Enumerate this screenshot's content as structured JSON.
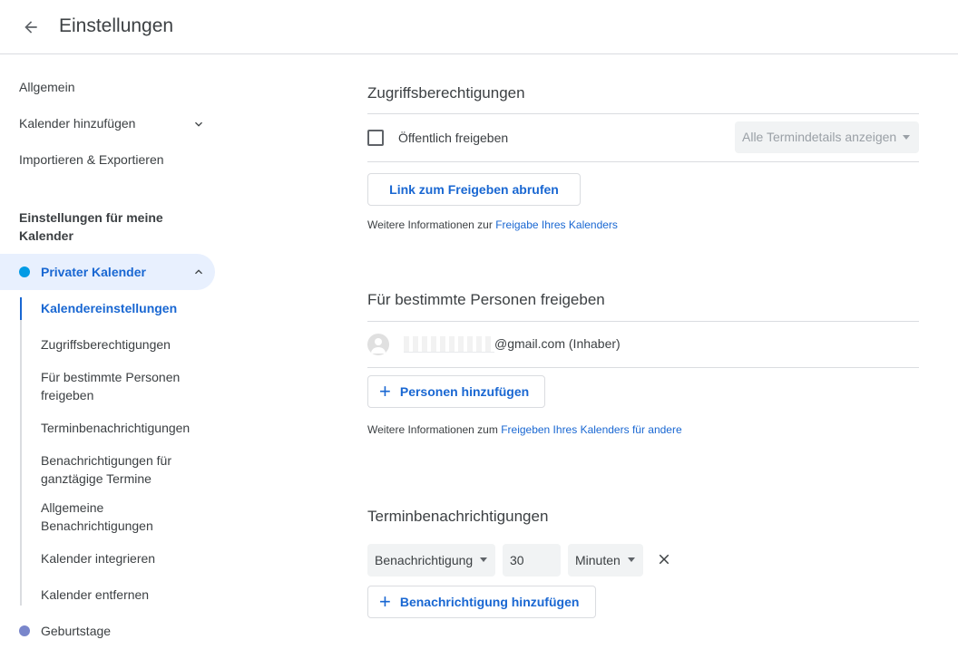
{
  "header": {
    "title": "Einstellungen"
  },
  "sidebar": {
    "items": [
      {
        "label": "Allgemein"
      },
      {
        "label": "Kalender hinzufügen"
      },
      {
        "label": "Importieren & Exportieren"
      }
    ],
    "section_heading": "Einstellungen für meine Kalender",
    "calendars": [
      {
        "label": "Privater Kalender",
        "color": "#039be5",
        "expanded": true,
        "sub_items": [
          {
            "label": "Kalendereinstellungen",
            "active": true
          },
          {
            "label": "Zugriffsberechtigungen"
          },
          {
            "label": "Für bestimmte Personen freigeben"
          },
          {
            "label": "Terminbenachrichtigungen"
          },
          {
            "label": "Benachrichtigungen für ganztägige Termine"
          },
          {
            "label": "Allgemeine Benachrichtigungen"
          },
          {
            "label": "Kalender integrieren"
          },
          {
            "label": "Kalender entfernen"
          }
        ]
      },
      {
        "label": "Geburtstage",
        "color": "#7986cb"
      }
    ]
  },
  "access": {
    "title": "Zugriffsberechtigungen",
    "public_label": "Öffentlich freigeben",
    "public_checked": false,
    "details_select": "Alle Termindetails anzeigen",
    "link_button": "Link zum Freigeben abrufen",
    "info_prefix": "Weitere Informationen zur ",
    "info_link": "Freigabe Ihres Kalenders"
  },
  "share": {
    "title": "Für bestimmte Personen freigeben",
    "owner_email": "@gmail.com (Inhaber)",
    "add_button": "Personen hinzufügen",
    "info_prefix": "Weitere Informationen zum ",
    "info_link": "Freigeben Ihres Kalenders für andere"
  },
  "notifications": {
    "title": "Terminbenachrichtigungen",
    "type": "Benachrichtigung",
    "amount": "30",
    "unit": "Minuten",
    "add_button": "Benachrichtigung hinzufügen"
  },
  "colors": {
    "accent": "#1967d2",
    "active_bg": "#e8f0fe"
  }
}
